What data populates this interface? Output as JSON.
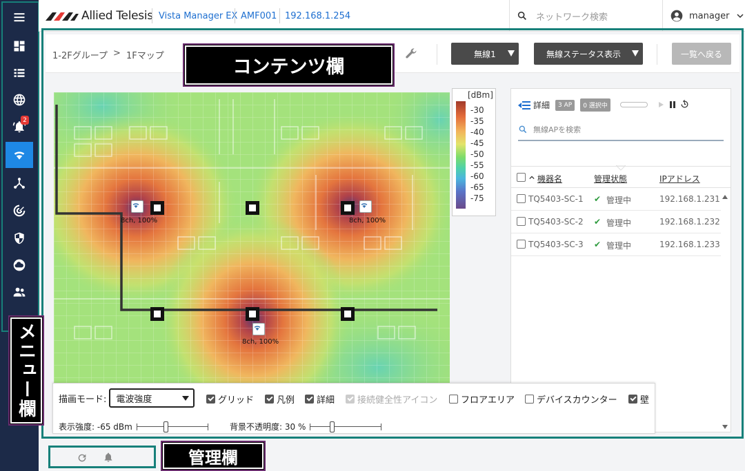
{
  "header": {
    "brand": "Allied Telesis",
    "app_name": "Vista Manager EX",
    "device": "AMF001",
    "ip": "192.168.1.254",
    "search_placeholder": "ネットワーク検索",
    "user": "manager"
  },
  "sidebar": {
    "items": [
      {
        "name": "menu-toggle",
        "icon": "hamburger-icon"
      },
      {
        "name": "dashboard",
        "icon": "dashboard-icon"
      },
      {
        "name": "list",
        "icon": "list-icon"
      },
      {
        "name": "network",
        "icon": "globe-icon"
      },
      {
        "name": "alerts",
        "icon": "bell-icon",
        "badge": "2"
      },
      {
        "name": "wireless",
        "icon": "wifi-icon",
        "active": true
      },
      {
        "name": "topology",
        "icon": "hub-icon"
      },
      {
        "name": "monitor",
        "icon": "radar-icon"
      },
      {
        "name": "security",
        "icon": "shield-icon"
      },
      {
        "name": "cloud",
        "icon": "cloud-icon"
      },
      {
        "name": "users",
        "icon": "users-icon"
      }
    ]
  },
  "toolbar": {
    "breadcrumb_group": "1-2Fグループ",
    "breadcrumb_sep": ">",
    "breadcrumb_map": "1Fマップ",
    "wireless_select": "無線1",
    "status_select": "無線ステータス表示",
    "back_button": "一覧へ戻る"
  },
  "callouts": {
    "content": "コンテンツ欄",
    "menu": "メニュー欄",
    "management": "管理欄"
  },
  "legend": {
    "unit": "[dBm]",
    "labels": [
      "-30",
      "-35",
      "-40",
      "-45",
      "-50",
      "-55",
      "-60",
      "-65",
      "-75"
    ]
  },
  "map": {
    "aps": [
      {
        "label": "8ch, 100%"
      },
      {
        "label": "8ch, 100%"
      },
      {
        "label": "8ch, 100%"
      }
    ]
  },
  "panel": {
    "detail_label": "詳細",
    "ap_count": "3 AP",
    "selected_count": "0 選択中",
    "progress_fraction": 0.0,
    "search_placeholder": "無線APを検索",
    "columns": {
      "name": "機器名",
      "status": "管理状態",
      "ip": "IPアドレス"
    },
    "rows": [
      {
        "name": "TQ5403-SC-1",
        "status": "管理中",
        "ip": "192.168.1.231"
      },
      {
        "name": "TQ5403-SC-2",
        "status": "管理中",
        "ip": "192.168.1.232"
      },
      {
        "name": "TQ5403-SC-3",
        "status": "管理中",
        "ip": "192.168.1.233"
      }
    ]
  },
  "controls": {
    "mode_label": "描画モード:",
    "mode_value": "電波強度",
    "checkboxes": [
      {
        "label": "グリッド",
        "checked": true,
        "disabled": false
      },
      {
        "label": "凡例",
        "checked": true,
        "disabled": false
      },
      {
        "label": "詳細",
        "checked": true,
        "disabled": false
      },
      {
        "label": "接続健全性アイコン",
        "checked": true,
        "disabled": true
      },
      {
        "label": "フロアエリア",
        "checked": false,
        "disabled": false
      },
      {
        "label": "デバイスカウンター",
        "checked": false,
        "disabled": false
      },
      {
        "label": "壁",
        "checked": true,
        "disabled": false
      }
    ],
    "strength_label": "表示強度: -65 dBm",
    "strength_fraction": 0.4,
    "opacity_label": "背景不透明度: 30 %",
    "opacity_fraction": 0.3
  },
  "colors": {
    "sidebar_bg": "#1c2a48",
    "accent": "#1e88e5",
    "frame": "#17807a",
    "ok": "#2e9b3e"
  }
}
